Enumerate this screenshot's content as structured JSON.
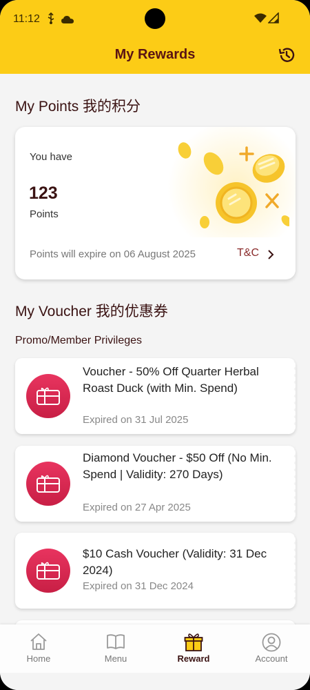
{
  "status_bar": {
    "time": "11:12",
    "icons": [
      "usb-icon",
      "cloud-icon",
      "wifi-icon",
      "signal-icon"
    ]
  },
  "header": {
    "title": "My Rewards",
    "history_icon": "history-icon"
  },
  "points_section": {
    "title": "My Points 我的积分",
    "you_have": "You have",
    "points_value": "123",
    "points_unit": "Points",
    "expiry_text": "Points will expire on 06 August 2025",
    "tc_label": "T&C"
  },
  "voucher_section": {
    "title": "My Voucher 我的优惠券",
    "category_label": "Promo/Member Privileges",
    "vouchers": [
      {
        "title": "Voucher - 50% Off Quarter Herbal Roast Duck (with Min. Spend)",
        "expiry": "Expired on 31 Jul 2025"
      },
      {
        "title": "Diamond Voucher - $50 Off (No Min. Spend | Validity: 270 Days)",
        "expiry": "Expired on 27 Apr 2025"
      },
      {
        "title": "$10 Cash Voucher (Validity: 31 Dec 2024)",
        "expiry": "Expired on 31 Dec 2024"
      }
    ]
  },
  "bottom_nav": {
    "items": [
      {
        "label": "Home",
        "icon": "home-icon"
      },
      {
        "label": "Menu",
        "icon": "menu-book-icon"
      },
      {
        "label": "Reward",
        "icon": "gift-icon",
        "active": true
      },
      {
        "label": "Account",
        "icon": "account-icon"
      }
    ]
  },
  "colors": {
    "header_bg": "#fccc16",
    "title_text": "#5a1414",
    "voucher_icon": "#d92a52",
    "background": "#f4f4f4"
  }
}
